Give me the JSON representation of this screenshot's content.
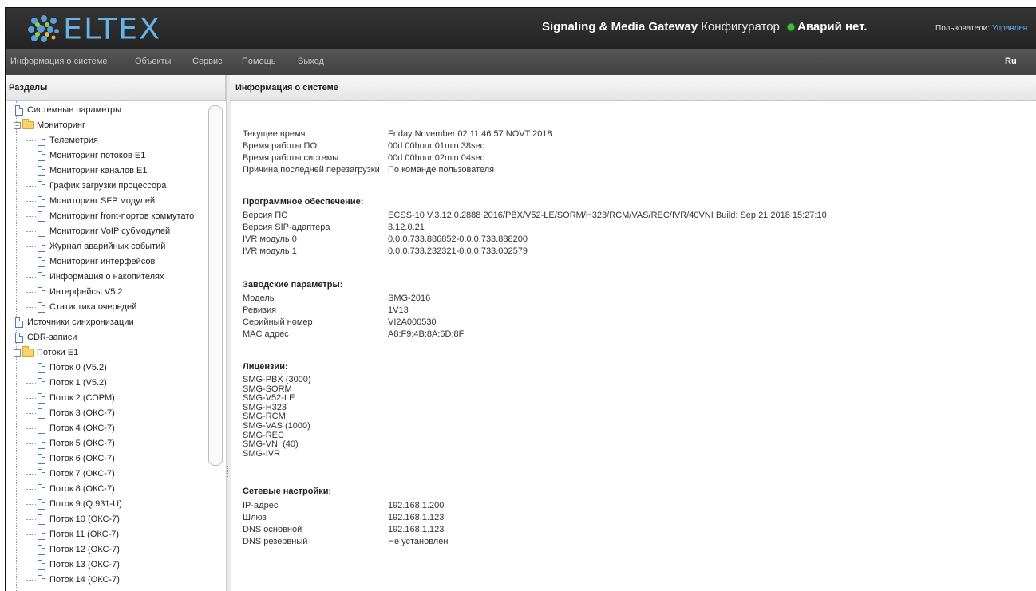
{
  "header": {
    "logo_text": "ELTEX",
    "title_bold": "Signaling & Media Gateway",
    "title_thin": "Конфигуратор",
    "alarm_text": "Аварий нет.",
    "users_label": "Пользователи:",
    "users_link": "Управлен"
  },
  "menu": {
    "items": [
      "Информация о системе",
      "Объекты",
      "Сервис",
      "Помощь",
      "Выход"
    ],
    "lang": "Ru"
  },
  "left_panel": {
    "title": "Разделы"
  },
  "right_panel": {
    "title": "Информация о системе"
  },
  "tree": {
    "system_params": "Системные параметры",
    "monitoring": "Мониторинг",
    "monitoring_children": [
      "Телеметрия",
      "Мониторинг потоков E1",
      "Мониторинг каналов E1",
      "График загрузки процессора",
      "Мониторинг SFP модулей",
      "Мониторинг front-портов коммутато",
      "Мониторинг VoIP субмодулей",
      "Журнал аварийных событий",
      "Мониторинг интерфейсов",
      "Информация о накопителях",
      "Интерфейсы V5.2",
      "Статистика очередей"
    ],
    "sync_sources": "Источники синхронизации",
    "cdr": "CDR-записи",
    "e1_streams": "Потоки E1",
    "e1_children": [
      "Поток 0 (V5.2)",
      "Поток 1 (V5.2)",
      "Поток 2 (СОРМ)",
      "Поток 3 (ОКС-7)",
      "Поток 4 (ОКС-7)",
      "Поток 5 (ОКС-7)",
      "Поток 6 (ОКС-7)",
      "Поток 7 (ОКС-7)",
      "Поток 8 (ОКС-7)",
      "Поток 9 (Q.931-U)",
      "Поток 10 (ОКС-7)",
      "Поток 11 (ОКС-7)",
      "Поток 12 (ОКС-7)",
      "Поток 13 (ОКС-7)",
      "Поток 14 (ОКС-7)"
    ]
  },
  "info": {
    "general": [
      {
        "k": "Текущее время",
        "v": "Friday November 02 11:46:57 NOVT 2018"
      },
      {
        "k": "Время работы ПО",
        "v": "00d 00hour 01min 38sec"
      },
      {
        "k": "Время работы системы",
        "v": "00d 00hour 02min 04sec"
      },
      {
        "k": "Причина последней перезагрузки",
        "v": "По команде пользователя"
      }
    ],
    "software_title": "Программное обеспечение:",
    "software": [
      {
        "k": "Версия ПО",
        "v": "ECSS-10 V.3.12.0.2888 2016/PBX/V52-LE/SORM/H323/RCM/VAS/REC/IVR/40VNI Build: Sep 21 2018 15:27:10"
      },
      {
        "k": "Версия SIP-адаптера",
        "v": "3.12.0.21"
      },
      {
        "k": "IVR модуль 0",
        "v": "0.0.0.733.886852-0.0.0.733.888200"
      },
      {
        "k": "IVR модуль 1",
        "v": "0.0.0.733.232321-0.0.0.733.002579"
      }
    ],
    "factory_title": "Заводские параметры:",
    "factory": [
      {
        "k": "Модель",
        "v": "SMG-2016"
      },
      {
        "k": "Ревизия",
        "v": "1V13"
      },
      {
        "k": "Серийный номер",
        "v": "VI2A000530"
      },
      {
        "k": "MAC адрес",
        "v": "A8:F9:4B:8A:6D:8F"
      }
    ],
    "licenses_title": "Лицензии:",
    "licenses": [
      "SMG-PBX (3000)",
      "SMG-SORM",
      "SMG-V52-LE",
      "SMG-H323",
      "SMG-RCM",
      "SMG-VAS (1000)",
      "SMG-REC",
      "SMG-VNI (40)",
      "SMG-IVR"
    ],
    "network_title": "Сетевые настройки:",
    "network": [
      {
        "k": "IP-адрес",
        "v": "192.168.1.200"
      },
      {
        "k": "Шлюз",
        "v": "192.168.1.123"
      },
      {
        "k": "DNS основной",
        "v": "192.168.1.123"
      },
      {
        "k": "DNS резервный",
        "v": "Не установлен"
      }
    ]
  }
}
